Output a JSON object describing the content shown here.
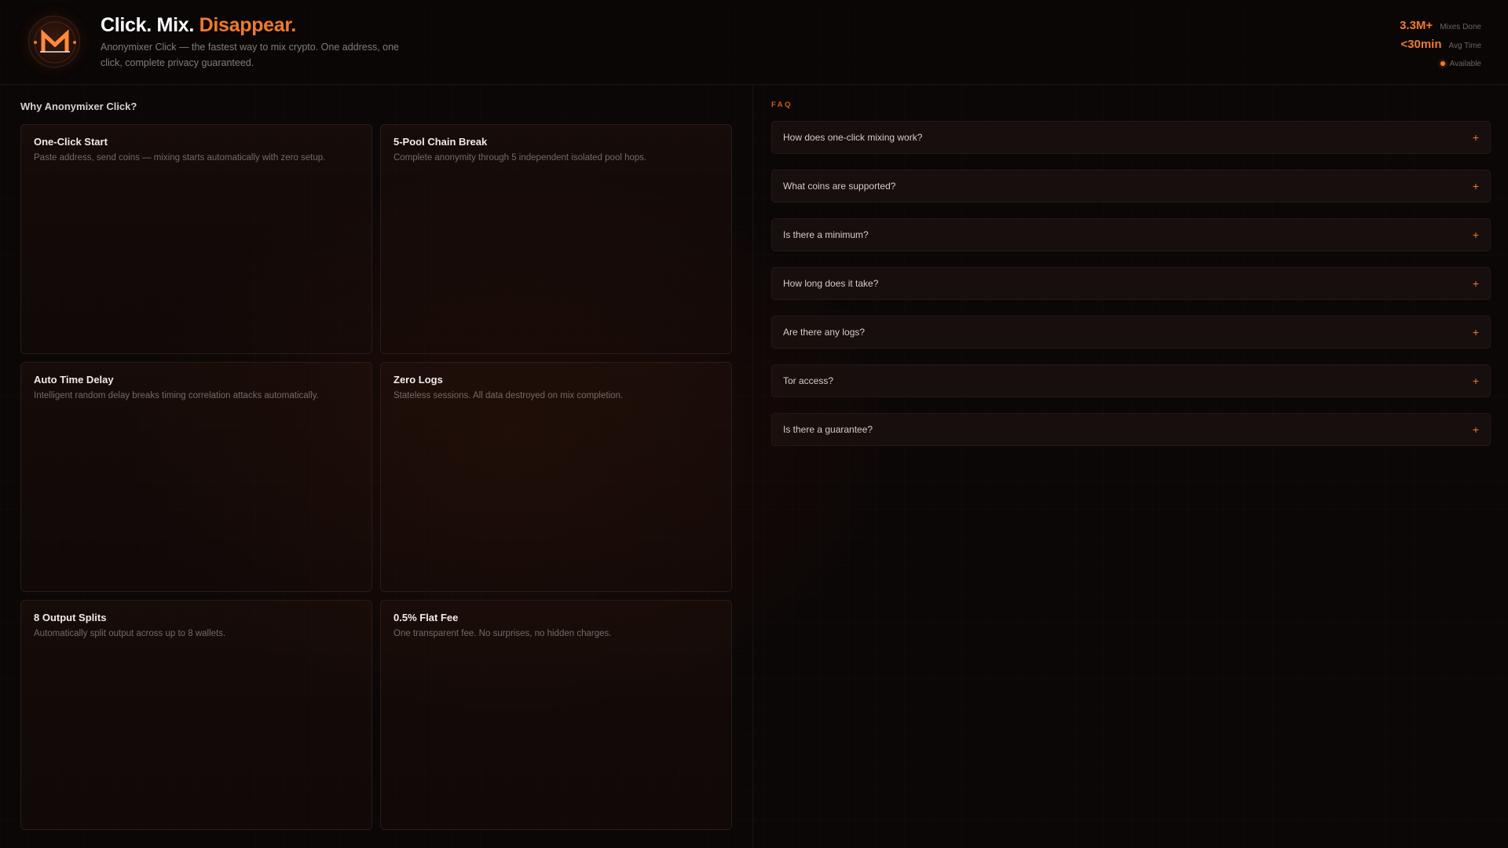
{
  "brand": {
    "title_part1": "Click. Mix. ",
    "title_accent": "Disappear.",
    "subtitle": "Anonymixer Click — the fastest way to mix crypto. One address, one click, complete privacy guaranteed.",
    "logo_icon": "monero-m-logo-icon",
    "logo_letter": "M"
  },
  "stats": [
    {
      "value": "3.3M+",
      "label": "Mixes Done"
    },
    {
      "value": "<30min",
      "label": "Avg Time"
    }
  ],
  "status": {
    "label": "Available",
    "color": "#f07a2c"
  },
  "features": {
    "heading": "Why Anonymixer Click?",
    "items": [
      {
        "title": "One-Click Start",
        "description": "Paste address, send coins — mixing starts automatically with zero setup."
      },
      {
        "title": "5-Pool Chain Break",
        "description": "Complete anonymity through 5 independent isolated pool hops."
      },
      {
        "title": "Auto Time Delay",
        "description": "Intelligent random delay breaks timing correlation attacks automatically."
      },
      {
        "title": "Zero Logs",
        "description": "Stateless sessions. All data destroyed on mix completion."
      },
      {
        "title": "8 Output Splits",
        "description": "Automatically split output across up to 8 wallets."
      },
      {
        "title": "0.5% Flat Fee",
        "description": "One transparent fee. No surprises, no hidden charges."
      }
    ]
  },
  "faq": {
    "heading": "FAQ",
    "expand_icon": "plus-icon",
    "expand_glyph": "+",
    "items": [
      {
        "question": "How does one-click mixing work?"
      },
      {
        "question": "What coins are supported?"
      },
      {
        "question": "Is there a minimum?"
      },
      {
        "question": "How long does it take?"
      },
      {
        "question": "Are there any logs?"
      },
      {
        "question": "Tor access?"
      },
      {
        "question": "Is there a guarantee?"
      }
    ]
  },
  "colors": {
    "accent": "#f07a2c",
    "background": "#0c0707",
    "card_border": "#2a1c17"
  }
}
